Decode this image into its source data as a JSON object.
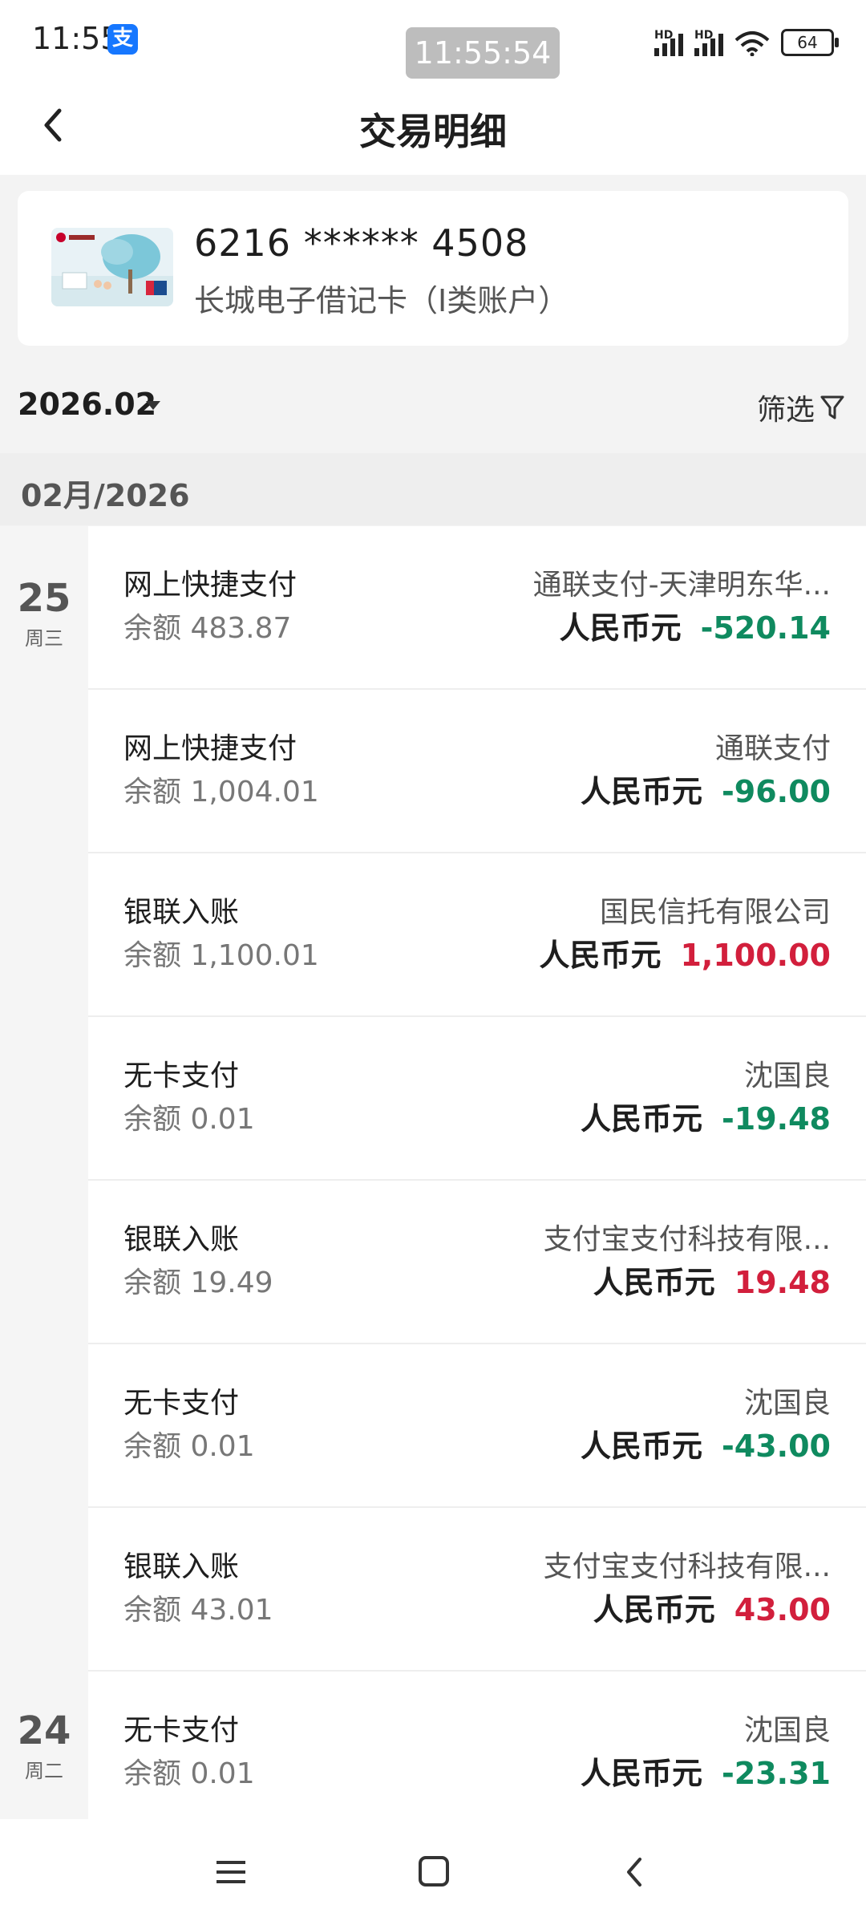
{
  "status_bar": {
    "time": "11:55",
    "app_icon_glyph": "支",
    "overlay_clock": "11:55:54",
    "hd_label": "HD",
    "battery": "64"
  },
  "header": {
    "title": "交易明细"
  },
  "card": {
    "number": "6216 ****** 4508",
    "name": "长城电子借记卡（I类账户）"
  },
  "filter": {
    "month": "2026.02",
    "filter_label": "筛选"
  },
  "section_label": "02月/2026",
  "days": [
    {
      "day": "25",
      "weekday": "周三"
    },
    {
      "day": "24",
      "weekday": "周二"
    }
  ],
  "transactions": [
    {
      "type": "网上快捷支付",
      "balance": "余额 483.87",
      "party": "通联支付-天津明东华...",
      "currency": "人民币元",
      "amount": "-520.14",
      "sign": "neg"
    },
    {
      "type": "网上快捷支付",
      "balance": "余额 1,004.01",
      "party": "通联支付",
      "currency": "人民币元",
      "amount": "-96.00",
      "sign": "neg"
    },
    {
      "type": "银联入账",
      "balance": "余额 1,100.01",
      "party": "国民信托有限公司",
      "currency": "人民币元",
      "amount": "1,100.00",
      "sign": "pos"
    },
    {
      "type": "无卡支付",
      "balance": "余额 0.01",
      "party": "沈国良",
      "currency": "人民币元",
      "amount": "-19.48",
      "sign": "neg"
    },
    {
      "type": "银联入账",
      "balance": "余额 19.49",
      "party": "支付宝支付科技有限...",
      "currency": "人民币元",
      "amount": "19.48",
      "sign": "pos"
    },
    {
      "type": "无卡支付",
      "balance": "余额 0.01",
      "party": "沈国良",
      "currency": "人民币元",
      "amount": "-43.00",
      "sign": "neg"
    },
    {
      "type": "银联入账",
      "balance": "余额 43.01",
      "party": "支付宝支付科技有限...",
      "currency": "人民币元",
      "amount": "43.00",
      "sign": "pos"
    },
    {
      "type": "无卡支付",
      "balance": "余额 0.01",
      "party": "沈国良",
      "currency": "人民币元",
      "amount": "-23.31",
      "sign": "neg"
    }
  ],
  "colors": {
    "negative": "#0f8a5f",
    "positive": "#d21f3c"
  },
  "icons": {
    "back": "chevron-left-icon",
    "filter": "funnel-icon",
    "nav_menu": "menu-icon",
    "nav_home": "home-square-icon",
    "nav_back": "back-chevron-icon"
  }
}
